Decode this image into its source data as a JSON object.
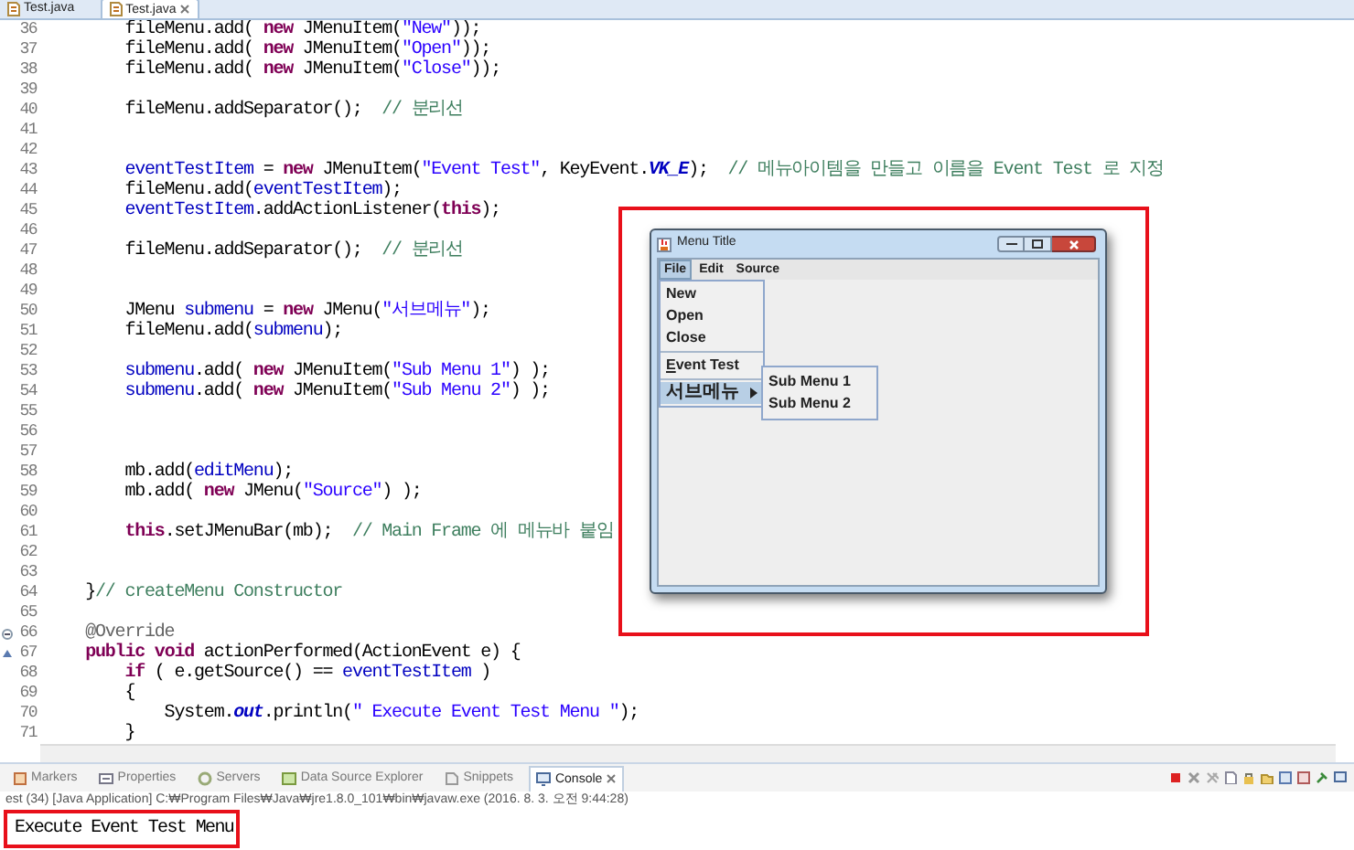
{
  "editor_tabs": [
    {
      "label": "Test.java",
      "selected": false
    },
    {
      "label": "Test.java",
      "selected": true
    }
  ],
  "code_lines": [
    {
      "number": "36",
      "tokens": [
        {
          "kind": "plain",
          "text": "        fileMenu.add( "
        },
        {
          "kind": "kw",
          "text": "new"
        },
        {
          "kind": "plain",
          "text": " JMenuItem("
        },
        {
          "kind": "str",
          "text": "\"New\""
        },
        {
          "kind": "plain",
          "text": "));"
        }
      ]
    },
    {
      "number": "37",
      "tokens": [
        {
          "kind": "plain",
          "text": "        fileMenu.add( "
        },
        {
          "kind": "kw",
          "text": "new"
        },
        {
          "kind": "plain",
          "text": " JMenuItem("
        },
        {
          "kind": "str",
          "text": "\"Open\""
        },
        {
          "kind": "plain",
          "text": "));"
        }
      ]
    },
    {
      "number": "38",
      "tokens": [
        {
          "kind": "plain",
          "text": "        fileMenu.add( "
        },
        {
          "kind": "kw",
          "text": "new"
        },
        {
          "kind": "plain",
          "text": " JMenuItem("
        },
        {
          "kind": "str",
          "text": "\"Close\""
        },
        {
          "kind": "plain",
          "text": "));"
        }
      ]
    },
    {
      "number": "39"
    },
    {
      "number": "40",
      "tokens": [
        {
          "kind": "plain",
          "text": "        fileMenu.addSeparator();  "
        },
        {
          "kind": "comment",
          "text": "// 분리선"
        }
      ]
    },
    {
      "number": "41"
    },
    {
      "number": "42"
    },
    {
      "number": "43",
      "tokens": [
        {
          "kind": "field",
          "text": "        eventTestItem"
        },
        {
          "kind": "plain",
          "text": " = "
        },
        {
          "kind": "kw",
          "text": "new"
        },
        {
          "kind": "plain",
          "text": " JMenuItem("
        },
        {
          "kind": "str",
          "text": "\"Event Test\""
        },
        {
          "kind": "plain",
          "text": ", KeyEvent."
        },
        {
          "kind": "static",
          "text": "VK_E"
        },
        {
          "kind": "plain",
          "text": ");  "
        },
        {
          "kind": "comment",
          "text": "// 메뉴아이템을 만들고 이름을 Event Test 로 지정"
        }
      ]
    },
    {
      "number": "44",
      "tokens": [
        {
          "kind": "plain",
          "text": "        fileMenu.add("
        },
        {
          "kind": "field",
          "text": "eventTestItem"
        },
        {
          "kind": "plain",
          "text": ");"
        }
      ]
    },
    {
      "number": "45",
      "tokens": [
        {
          "kind": "field",
          "text": "        eventTestItem"
        },
        {
          "kind": "plain",
          "text": ".addActionListener("
        },
        {
          "kind": "kw",
          "text": "this"
        },
        {
          "kind": "plain",
          "text": ");"
        }
      ]
    },
    {
      "number": "46"
    },
    {
      "number": "47",
      "tokens": [
        {
          "kind": "plain",
          "text": "        fileMenu.addSeparator();  "
        },
        {
          "kind": "comment",
          "text": "// 분리선"
        }
      ]
    },
    {
      "number": "48"
    },
    {
      "number": "49"
    },
    {
      "number": "50",
      "tokens": [
        {
          "kind": "plain",
          "text": "        JMenu "
        },
        {
          "kind": "field",
          "text": "submenu"
        },
        {
          "kind": "plain",
          "text": " = "
        },
        {
          "kind": "kw",
          "text": "new"
        },
        {
          "kind": "plain",
          "text": " JMenu("
        },
        {
          "kind": "str",
          "text": "\"서브메뉴\""
        },
        {
          "kind": "plain",
          "text": ");"
        }
      ]
    },
    {
      "number": "51",
      "tokens": [
        {
          "kind": "plain",
          "text": "        fileMenu.add("
        },
        {
          "kind": "field",
          "text": "submenu"
        },
        {
          "kind": "plain",
          "text": ");"
        }
      ]
    },
    {
      "number": "52"
    },
    {
      "number": "53",
      "tokens": [
        {
          "kind": "field",
          "text": "        submenu"
        },
        {
          "kind": "plain",
          "text": ".add( "
        },
        {
          "kind": "kw",
          "text": "new"
        },
        {
          "kind": "plain",
          "text": " JMenuItem("
        },
        {
          "kind": "str",
          "text": "\"Sub Menu 1\""
        },
        {
          "kind": "plain",
          "text": ") );"
        }
      ]
    },
    {
      "number": "54",
      "tokens": [
        {
          "kind": "field",
          "text": "        submenu"
        },
        {
          "kind": "plain",
          "text": ".add( "
        },
        {
          "kind": "kw",
          "text": "new"
        },
        {
          "kind": "plain",
          "text": " JMenuItem("
        },
        {
          "kind": "str",
          "text": "\"Sub Menu 2\""
        },
        {
          "kind": "plain",
          "text": ") );"
        }
      ]
    },
    {
      "number": "55"
    },
    {
      "number": "56"
    },
    {
      "number": "57"
    },
    {
      "number": "58",
      "tokens": [
        {
          "kind": "plain",
          "text": "        mb.add("
        },
        {
          "kind": "field",
          "text": "editMenu"
        },
        {
          "kind": "plain",
          "text": ");"
        }
      ]
    },
    {
      "number": "59",
      "tokens": [
        {
          "kind": "plain",
          "text": "        mb.add( "
        },
        {
          "kind": "kw",
          "text": "new"
        },
        {
          "kind": "plain",
          "text": " JMenu("
        },
        {
          "kind": "str",
          "text": "\"Source\""
        },
        {
          "kind": "plain",
          "text": ") );"
        }
      ]
    },
    {
      "number": "60"
    },
    {
      "number": "61",
      "tokens": [
        {
          "kind": "kw",
          "text": "        this"
        },
        {
          "kind": "plain",
          "text": ".setJMenuBar(mb);  "
        },
        {
          "kind": "comment",
          "text": "// Main Frame 에 메뉴바 붙임"
        }
      ]
    },
    {
      "number": "62"
    },
    {
      "number": "63"
    },
    {
      "number": "64",
      "tokens": [
        {
          "kind": "plain",
          "text": "    }"
        },
        {
          "kind": "comment",
          "text": "// createMenu Constructor"
        }
      ]
    },
    {
      "number": "65"
    },
    {
      "number": "66",
      "foldable": true,
      "tokens": [
        {
          "kind": "annotation",
          "text": "    @Override"
        }
      ]
    },
    {
      "number": "67",
      "override_marker": true,
      "tokens": [
        {
          "kind": "kw",
          "text": "    public"
        },
        {
          "kind": "kw",
          "text": " void"
        },
        {
          "kind": "plain",
          "text": " actionPerformed(ActionEvent e) {"
        }
      ]
    },
    {
      "number": "68",
      "tokens": [
        {
          "kind": "kw",
          "text": "        if"
        },
        {
          "kind": "plain",
          "text": " ( e.getSource() == "
        },
        {
          "kind": "field",
          "text": "eventTestItem"
        },
        {
          "kind": "plain",
          "text": " )"
        }
      ]
    },
    {
      "number": "69",
      "tokens": [
        {
          "kind": "plain",
          "text": "        {"
        }
      ]
    },
    {
      "number": "70",
      "tokens": [
        {
          "kind": "plain",
          "text": "            System."
        },
        {
          "kind": "static",
          "text": "out"
        },
        {
          "kind": "plain",
          "text": ".println("
        },
        {
          "kind": "str",
          "text": "\" Execute Event Test Menu \""
        },
        {
          "kind": "plain",
          "text": ");"
        }
      ]
    },
    {
      "number": "71",
      "tokens": [
        {
          "kind": "plain",
          "text": "        }"
        }
      ]
    }
  ],
  "swing_window": {
    "title": "Menu Title",
    "menus": [
      {
        "label": "File",
        "selected": true
      },
      {
        "label": "Edit",
        "selected": false
      },
      {
        "label": "Source",
        "selected": false
      }
    ],
    "file_menu": [
      {
        "kind": "item",
        "label": "New",
        "selected": false
      },
      {
        "kind": "item",
        "label": "Open",
        "selected": false
      },
      {
        "kind": "item",
        "label": "Close",
        "selected": false
      },
      {
        "kind": "separator"
      },
      {
        "kind": "item",
        "label": "Event Test",
        "mnemonic": true,
        "selected": false
      },
      {
        "kind": "separator"
      },
      {
        "kind": "submenu",
        "label": "서브메뉴",
        "selected": true
      }
    ],
    "submenu": [
      {
        "label": "Sub Menu 1",
        "selected": false
      },
      {
        "label": "Sub Menu 2",
        "selected": false
      }
    ]
  },
  "view_tabs": [
    {
      "label": "Markers",
      "selected": false
    },
    {
      "label": "Properties",
      "selected": false
    },
    {
      "label": "Servers",
      "selected": false
    },
    {
      "label": "Data Source Explorer",
      "selected": false
    },
    {
      "label": "Snippets",
      "selected": false
    },
    {
      "label": "Console",
      "selected": true
    }
  ],
  "console": {
    "header": "est (34) [Java Application] C:₩Program Files₩Java₩jre1.8.0_101₩bin₩javaw.exe (2016. 8. 3. 오전 9:44:28)",
    "output": "Execute Event Test Menu"
  }
}
